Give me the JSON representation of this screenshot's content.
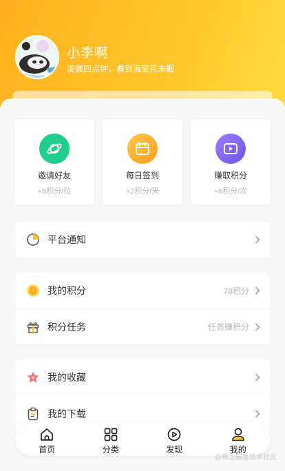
{
  "profile": {
    "nickname": "小李啊",
    "signature": "凌晨四点钟，看到海棠花未眠"
  },
  "quick_actions": [
    {
      "title": "邀请好友",
      "subtitle": "+6积分/位",
      "icon": "planet-icon",
      "color": "#1fcf8c"
    },
    {
      "title": "每日签到",
      "subtitle": "+2积分/天",
      "icon": "calendar-icon",
      "color": "#ffb233"
    },
    {
      "title": "赚取积分",
      "subtitle": "+6积分/次",
      "icon": "video-play-icon",
      "color": "#8a6af5"
    }
  ],
  "menu": {
    "notice": {
      "label": "平台通知"
    },
    "points": {
      "label": "我的积分",
      "value": "78积分"
    },
    "tasks": {
      "label": "积分任务",
      "value": "任务赚积分"
    },
    "favorites": {
      "label": "我的收藏"
    },
    "downloads": {
      "label": "我的下载"
    }
  },
  "tabbar": [
    {
      "label": "首页",
      "icon": "home-icon"
    },
    {
      "label": "分类",
      "icon": "grid-icon"
    },
    {
      "label": "发现",
      "icon": "discover-play-icon"
    },
    {
      "label": "我的",
      "icon": "user-icon",
      "active": true
    }
  ],
  "colors": {
    "header_start": "#ffb11f",
    "header_end": "#ffdc3d",
    "accent": "#ffc42a"
  },
  "watermark": "@稀土掘金技术社区"
}
